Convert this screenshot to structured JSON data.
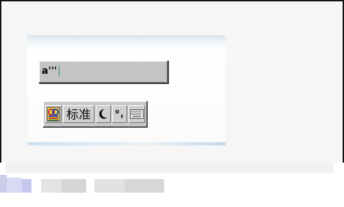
{
  "composition": {
    "text": "a'''"
  },
  "ime_toolbar": {
    "mode_label": "标准",
    "punct_glyph": "°,"
  },
  "colors": {
    "frame_border": "#111111",
    "ime_face": "#c8c8c8",
    "caret": "#2a8a8a"
  },
  "icons": [
    "ime-logo-icon",
    "half-width-moon-icon",
    "chinese-punctuation-icon",
    "soft-keyboard-icon"
  ]
}
